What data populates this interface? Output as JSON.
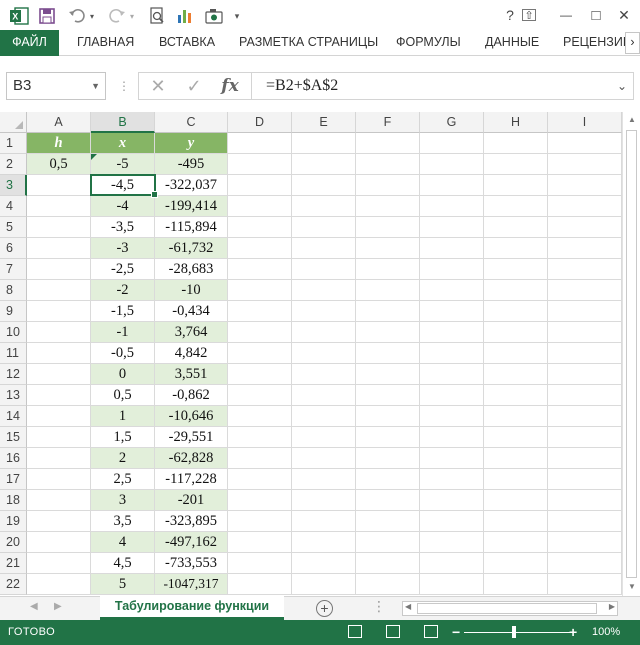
{
  "toolbar": {
    "icons": [
      "excel-logo-icon",
      "save-icon",
      "undo-icon",
      "redo-icon",
      "print-preview-icon",
      "chart-icon",
      "camera-icon",
      "customize-icon"
    ],
    "window": {
      "help": "?",
      "restore_ribbon": "⇧",
      "minimize": "—",
      "maximize": "□",
      "close": "✕"
    }
  },
  "ribbon": {
    "tabs": [
      "ФАЙЛ",
      "ГЛАВНАЯ",
      "ВСТАВКА",
      "РАЗМЕТКА СТРАНИЦЫ",
      "ФОРМУЛЫ",
      "ДАННЫЕ",
      "РЕЦЕНЗИРО"
    ],
    "scroll_right": "›"
  },
  "formula_bar": {
    "name_box": "B3",
    "cancel": "✕",
    "enter": "✓",
    "fx": "fx",
    "formula": "=B2+$A$2"
  },
  "grid": {
    "columns": [
      "A",
      "B",
      "C",
      "D",
      "E",
      "F",
      "G",
      "H",
      "I"
    ],
    "rows": [
      "1",
      "2",
      "3",
      "4",
      "5",
      "6",
      "7",
      "8",
      "9",
      "10",
      "11",
      "12",
      "13",
      "14",
      "15",
      "16",
      "17",
      "18",
      "19",
      "20",
      "21",
      "22"
    ],
    "header_row": {
      "A": "h",
      "B": "x",
      "C": "y"
    },
    "h_value": "0,5",
    "data": [
      [
        "-5",
        "-495"
      ],
      [
        "-4,5",
        "-322,037"
      ],
      [
        "-4",
        "-199,414"
      ],
      [
        "-3,5",
        "-115,894"
      ],
      [
        "-3",
        "-61,732"
      ],
      [
        "-2,5",
        "-28,683"
      ],
      [
        "-2",
        "-10"
      ],
      [
        "-1,5",
        "-0,434"
      ],
      [
        "-1",
        "3,764"
      ],
      [
        "-0,5",
        "4,842"
      ],
      [
        "0",
        "3,551"
      ],
      [
        "0,5",
        "-0,862"
      ],
      [
        "1",
        "-10,646"
      ],
      [
        "1,5",
        "-29,551"
      ],
      [
        "2",
        "-62,828"
      ],
      [
        "2,5",
        "-117,228"
      ],
      [
        "3",
        "-201"
      ],
      [
        "3,5",
        "-323,895"
      ],
      [
        "4",
        "-497,162"
      ],
      [
        "4,5",
        "-733,553"
      ],
      [
        "5",
        "-1047,317"
      ]
    ],
    "selected_cell": "B3",
    "colors": {
      "header_fill": "#86b565",
      "band_fill": "#e2efda",
      "accent": "#217346"
    }
  },
  "sheets": {
    "active": "Табулирование функции",
    "add": "+",
    "nav_prev": "◀",
    "nav_next": "▶"
  },
  "status_bar": {
    "text": "ГОТОВО",
    "zoom_minus": "−",
    "zoom_plus": "+",
    "zoom": "100%"
  }
}
